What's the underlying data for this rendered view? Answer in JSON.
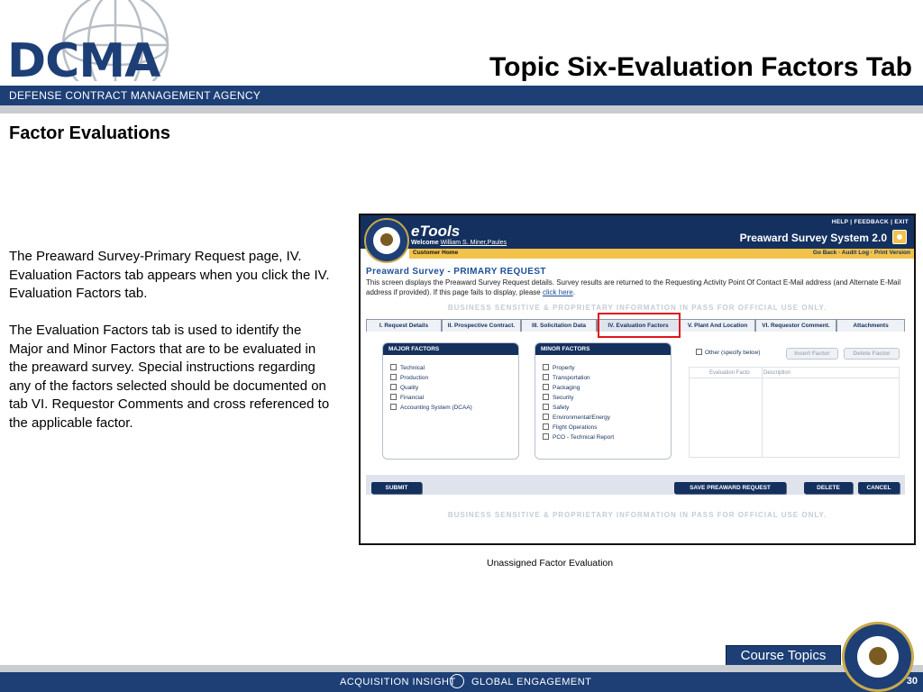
{
  "header": {
    "logo_text": "DCMA",
    "slide_title": "Topic Six-Evaluation Factors Tab",
    "agency_name": "DEFENSE CONTRACT MANAGEMENT AGENCY"
  },
  "content": {
    "heading": "Factor Evaluations",
    "paragraph1": "The Preaward Survey-Primary Request page, IV. Evaluation Factors tab appears when you click the IV. Evaluation Factors tab.",
    "paragraph2": "The Evaluation Factors tab is used to identify the Major and Minor Factors that are to be evaluated in the preaward survey. Special instructions regarding any of the factors selected should be documented on tab VI. Requestor Comments and cross referenced to the applicable factor.",
    "caption": "Unassigned Factor Evaluation"
  },
  "screenshot": {
    "app_logo": "eTools",
    "welcome": "Welcome",
    "user_name": "William S. Miner,Paules",
    "top_links": "HELP | FEEDBACK | EXIT",
    "system_name": "Preaward Survey System 2.0",
    "customer_home": "Customer Home",
    "nav_links": "Go Back · Audit Log · Print Version",
    "page_heading": "Preaward Survey - PRIMARY REQUEST",
    "description": "This screen displays the Preaward Survey Request details. Survey results are returned to the Requesting Activity Point Of Contact E-Mail address (and Alternate E-Mail address if provided). If this page fails to display, please",
    "description_link": "click here",
    "description_end": ".",
    "banner": "BUSINESS SENSITIVE & PROPRIETARY INFORMATION IN PASS FOR OFFICIAL USE ONLY.",
    "tabs": [
      "I. Request Details",
      "II. Prospective Contract.",
      "III. Solicitation Data",
      "IV. Evaluation Factors",
      "V. Plant And Location",
      "VI. Requestor Comment.",
      "Attachments"
    ],
    "active_tab": "IV. Evaluation Factors",
    "major_factors": {
      "title": "MAJOR FACTORS",
      "items": [
        "Technical",
        "Production",
        "Quality",
        "Financial",
        "Accounting System (DCAA)"
      ]
    },
    "minor_factors": {
      "title": "MINOR FACTORS",
      "items": [
        "Property",
        "Transportation",
        "Packaging",
        "Security",
        "Safety",
        "Environmental/Energy",
        "Flight Operations",
        "PCO - Technical Report"
      ]
    },
    "other_label": "Other (specify below)",
    "insert_factor": "Insert Factor",
    "delete_factor": "Delete Factor",
    "table_headers": [
      "Evaluation Facto",
      "Description"
    ],
    "buttons": {
      "submit": "SUBMIT",
      "save": "SAVE PREAWARD REQUEST",
      "delete": "DELETE",
      "cancel": "CANCEL"
    }
  },
  "footer": {
    "course_topics": "Course Topics",
    "tagline_left": "ACQUISITION INSIGHT",
    "tagline_right": "GLOBAL ENGAGEMENT",
    "page_number": "30"
  },
  "colors": {
    "brand_navy": "#1d3f76",
    "etools_navy": "#14305e",
    "accent_yellow": "#f2c24a",
    "highlight_red": "#e0161b"
  }
}
